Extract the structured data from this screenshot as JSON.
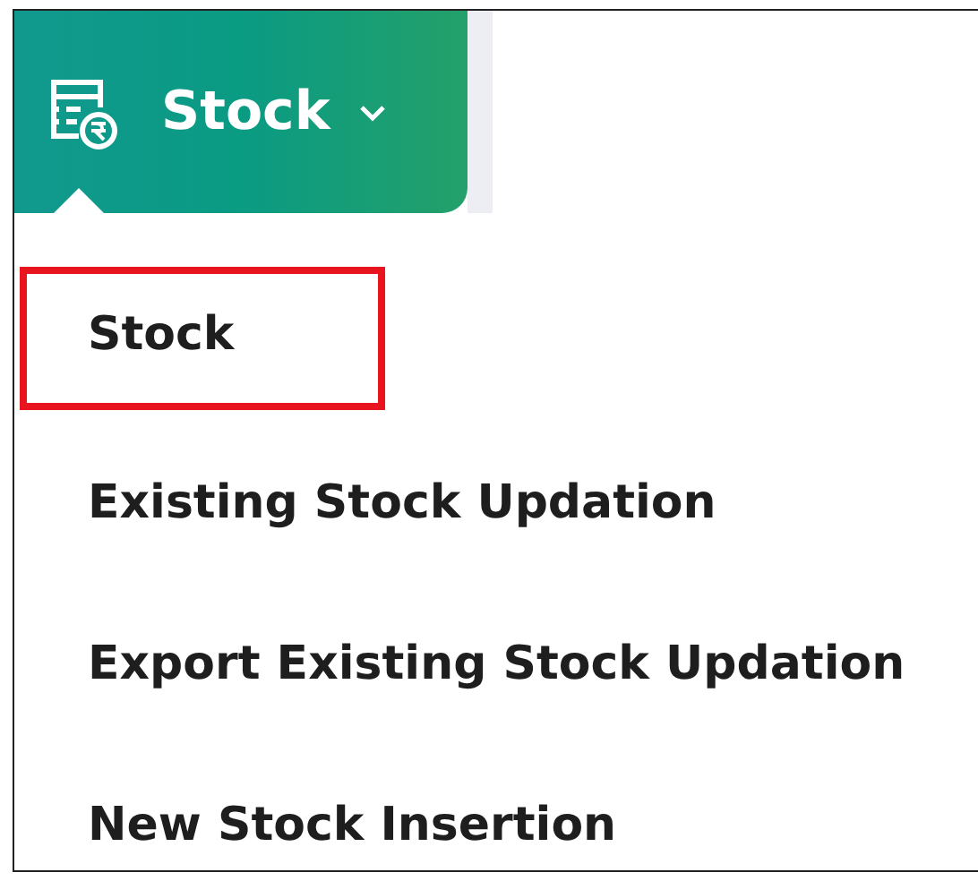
{
  "menu_button": {
    "label": "Stock",
    "expanded": true
  },
  "menu_items": [
    {
      "label": "Stock",
      "selected": true
    },
    {
      "label": "Existing Stock Updation",
      "selected": false
    },
    {
      "label": "Export Existing Stock Updation",
      "selected": false
    },
    {
      "label": "New Stock Insertion",
      "selected": false
    }
  ]
}
